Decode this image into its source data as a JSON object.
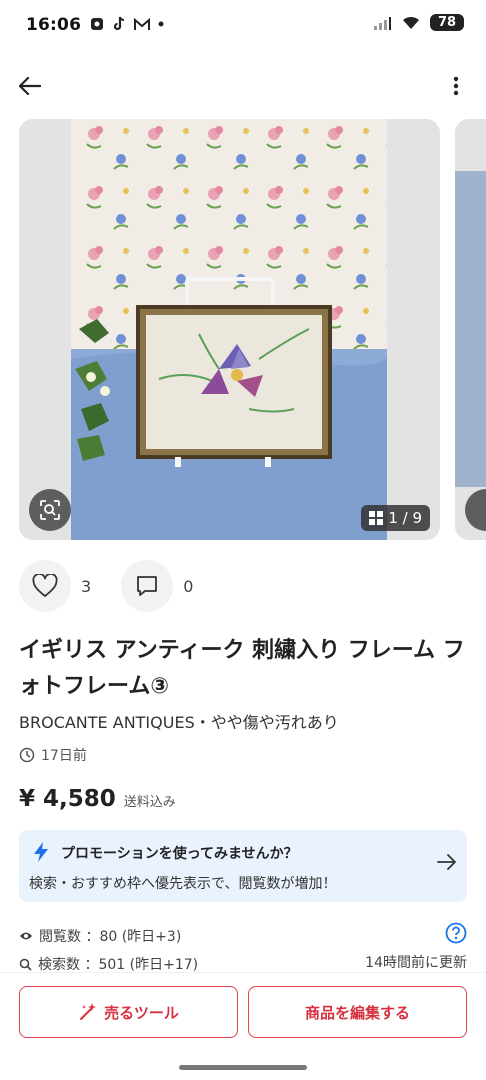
{
  "status_bar": {
    "time": "16:06",
    "battery": "78"
  },
  "carousel": {
    "counter": "1 / 9"
  },
  "actions": {
    "likes": "3",
    "comments": "0"
  },
  "item": {
    "title": "イギリス アンティーク 刺繍入り フレーム フォトフレーム③",
    "subtitle": "BROCANTE ANTIQUES・やや傷や汚れあり",
    "posted": "17日前",
    "price": "¥ 4,580",
    "shipping": "送料込み"
  },
  "promo": {
    "title": "プロモーションを使ってみませんか？",
    "description": "検索・おすすめ枠へ優先表示で、閲覧数が増加！"
  },
  "stats": {
    "views": "閲覧数 ：80 (昨日+3)",
    "searches": "検索数 ：501 (昨日+17)",
    "updated": "14時間前に更新"
  },
  "bottom": {
    "tools_label": "売るツール",
    "edit_label": "商品を編集する"
  },
  "colors": {
    "accent": "#e8404f",
    "promo_bg": "#eaf3fd",
    "link_blue": "#1a73e8"
  }
}
